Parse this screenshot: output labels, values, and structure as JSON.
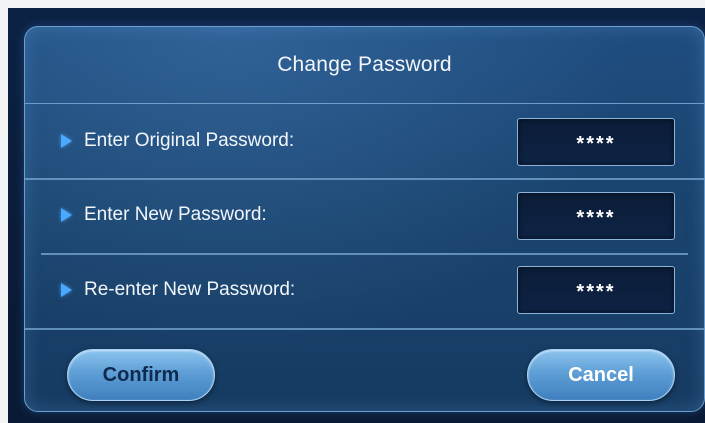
{
  "dialog": {
    "title": "Change Password",
    "rows": [
      {
        "label": "Enter Original Password:",
        "value": "****"
      },
      {
        "label": "Enter New Password:",
        "value": "****"
      },
      {
        "label": "Re-enter New Password:",
        "value": "****"
      }
    ],
    "buttons": {
      "confirm": "Confirm",
      "cancel": "Cancel"
    }
  },
  "colors": {
    "dialog_bg": "#1a446f",
    "accent_arrow": "#4aa8ff",
    "field_bg": "#0b1d38",
    "button_bg": "#5f9fd6"
  },
  "icons": {
    "row_marker": "play-triangle-icon"
  }
}
